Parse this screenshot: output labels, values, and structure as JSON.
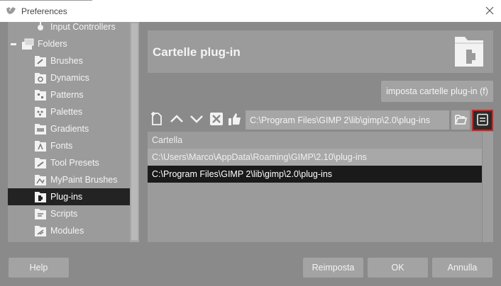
{
  "window": {
    "title": "Preferences"
  },
  "sidebar": {
    "items": [
      {
        "label": "Input Controllers",
        "icon": "input-controllers-icon"
      },
      {
        "label": "Folders",
        "icon": "folders-icon"
      },
      {
        "label": "Brushes",
        "icon": "brushes-folder-icon"
      },
      {
        "label": "Dynamics",
        "icon": "dynamics-folder-icon"
      },
      {
        "label": "Patterns",
        "icon": "patterns-folder-icon"
      },
      {
        "label": "Palettes",
        "icon": "palettes-folder-icon"
      },
      {
        "label": "Gradients",
        "icon": "gradients-folder-icon"
      },
      {
        "label": "Fonts",
        "icon": "fonts-folder-icon"
      },
      {
        "label": "Tool Presets",
        "icon": "tool-presets-folder-icon"
      },
      {
        "label": "MyPaint Brushes",
        "icon": "mypaint-brushes-folder-icon"
      },
      {
        "label": "Plug-ins",
        "icon": "plugins-folder-icon",
        "selected": true
      },
      {
        "label": "Scripts",
        "icon": "scripts-folder-icon"
      },
      {
        "label": "Modules",
        "icon": "modules-folder-icon"
      }
    ]
  },
  "main": {
    "title": "Cartelle plug-in",
    "set_folders_button": "imposta cartelle plug-in (f)",
    "path_value": "C:\\Program Files\\GIMP 2\\lib\\gimp\\2.0\\plug-ins",
    "list": {
      "header": "Cartella",
      "rows": [
        "C:\\Users\\Marco\\AppData\\Roaming\\GIMP\\2.10\\plug-ins",
        "C:\\Program Files\\GIMP 2\\lib\\gimp\\2.0\\plug-ins"
      ]
    }
  },
  "buttons": {
    "help": "Help",
    "reset": "Reimposta",
    "ok": "OK",
    "cancel": "Annulla"
  },
  "colors": {
    "selection": "#1a1a1a",
    "highlight_border": "#e31b1b"
  }
}
